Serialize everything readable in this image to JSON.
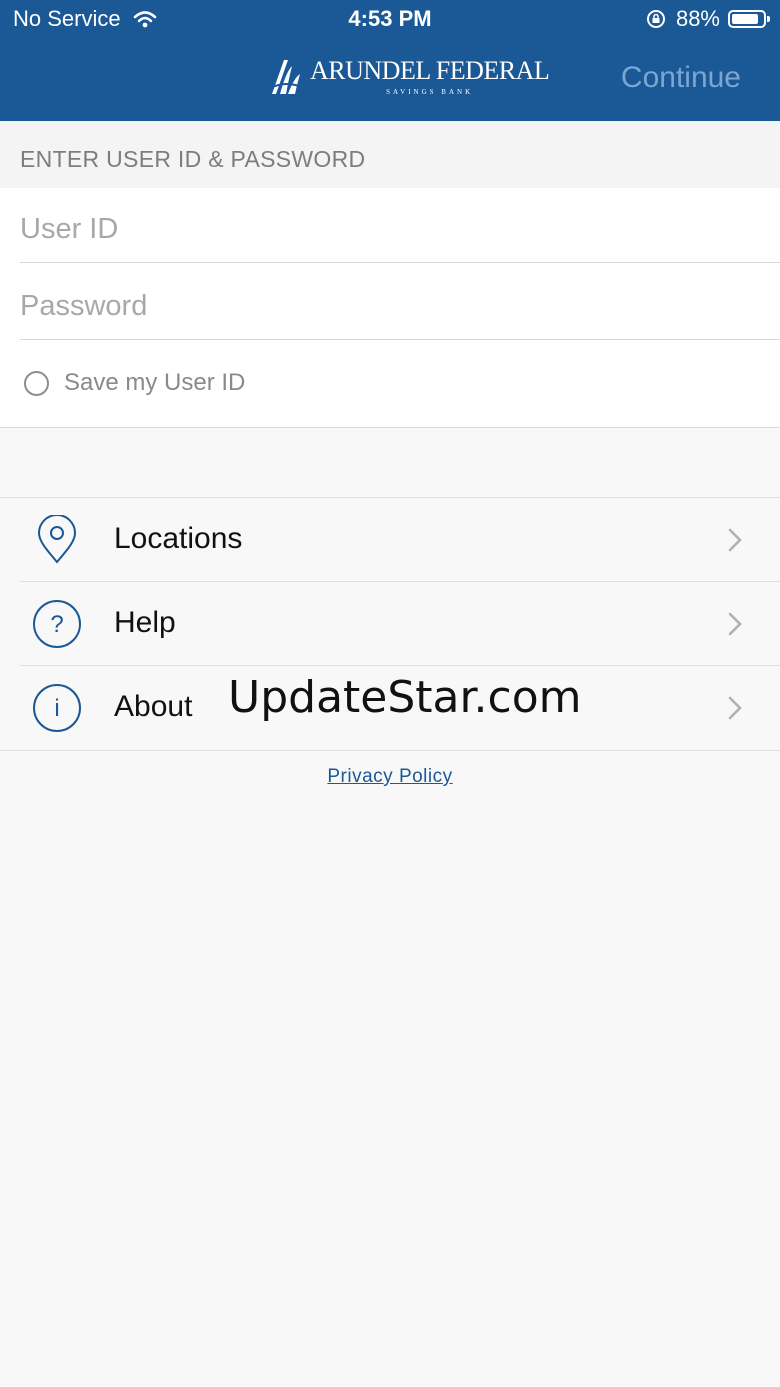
{
  "status_bar": {
    "carrier": "No Service",
    "time": "4:53 PM",
    "battery": "88%",
    "battery_level": 0.88,
    "icons": [
      "wifi-icon",
      "rotation-lock-icon",
      "battery-icon"
    ]
  },
  "nav": {
    "logo_name": "ARUNDEL FEDERAL",
    "logo_sub": "SAVINGS BANK",
    "continue_label": "Continue"
  },
  "login": {
    "section_title": "ENTER USER ID & PASSWORD",
    "user_id_placeholder": "User ID",
    "user_id_value": "",
    "password_placeholder": "Password",
    "password_value": "",
    "save_label": "Save my User ID",
    "save_checked": false
  },
  "menu": {
    "items": [
      {
        "label": "Locations",
        "icon": "location-pin-icon"
      },
      {
        "label": "Help",
        "icon": "question-circle-icon"
      },
      {
        "label": "About",
        "icon": "info-circle-icon"
      }
    ]
  },
  "footer": {
    "privacy_label": "Privacy Policy"
  },
  "watermark": "UpdateStar.com",
  "colors": {
    "header_bg": "#1a5896",
    "continue_text": "#7ba6d2",
    "icon_blue": "#1a5896",
    "background": "#f8f8f8"
  }
}
